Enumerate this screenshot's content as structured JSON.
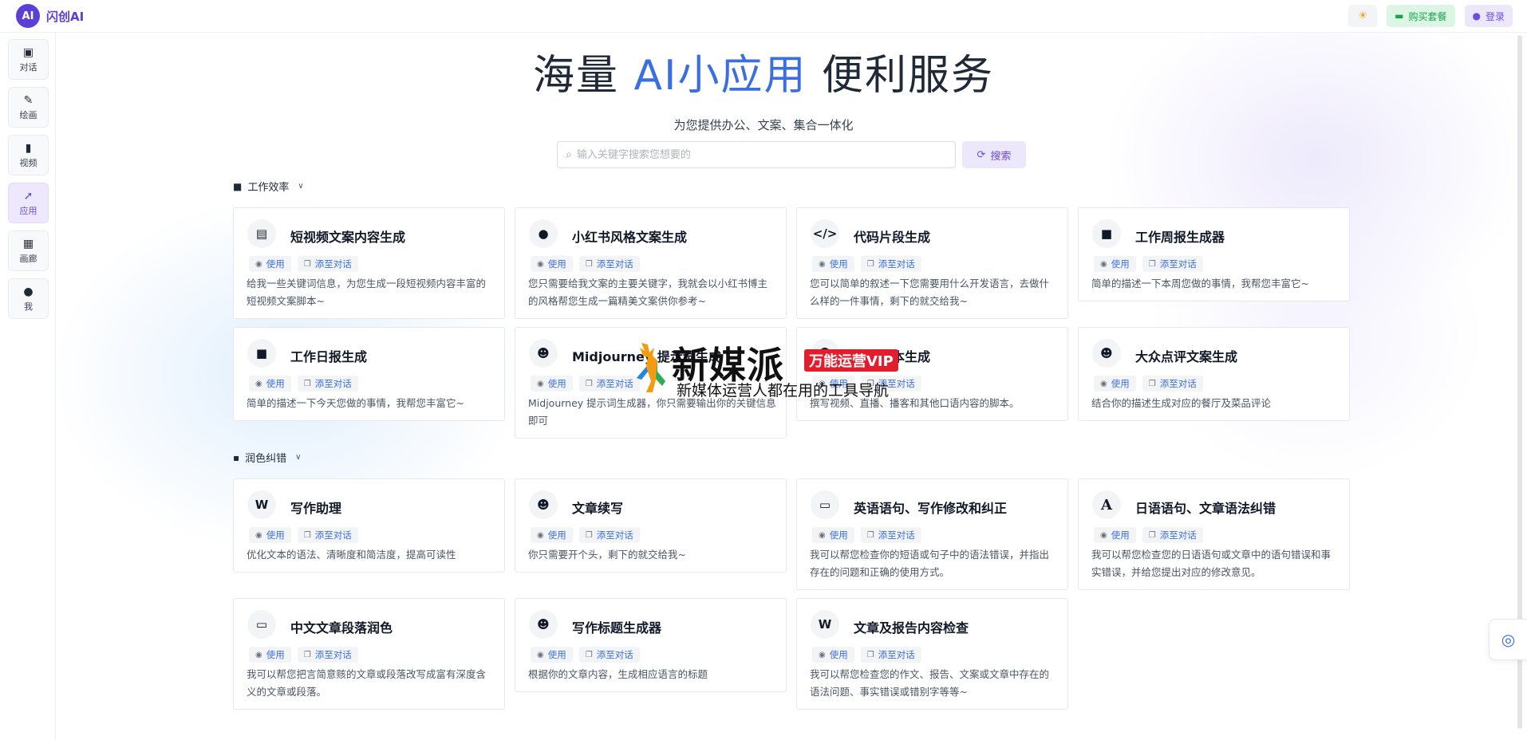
{
  "app": {
    "logo_mark": "AI",
    "name": "闪创AI"
  },
  "topbar": {
    "theme_icon": "sun-icon",
    "buy_label": "购买套餐",
    "login_label": "登录"
  },
  "sidebar": {
    "items": [
      {
        "label": "对话",
        "icon": "chat-icon"
      },
      {
        "label": "绘画",
        "icon": "brush-icon"
      },
      {
        "label": "视频",
        "icon": "video-icon"
      },
      {
        "label": "应用",
        "icon": "rocket-icon",
        "active": true
      },
      {
        "label": "画廊",
        "icon": "gallery-icon"
      },
      {
        "label": "我",
        "icon": "user-icon"
      }
    ]
  },
  "hero": {
    "title_pre": "海量 ",
    "title_accent": "AI小应用",
    "title_post": " 便利服务",
    "subtitle": "为您提供办公、文案、集合一体化"
  },
  "search": {
    "placeholder": "输入关键字搜索您想要的",
    "button": "搜索"
  },
  "card_actions": {
    "use": "使用",
    "add": "添至对话"
  },
  "sections": [
    {
      "title": "工作效率",
      "cards": [
        {
          "title": "短视频文案内容生成",
          "icon": "image-stack-icon",
          "desc": "给我一些关键词信息，为您生成一段短视频内容丰富的短视频文案脚本~"
        },
        {
          "title": "小红书风格文案生成",
          "icon": "cookie-icon",
          "desc": "您只需要给我文案的主要关键字，我就会以小红书博主的风格帮您生成一篇精美文案供你参考~"
        },
        {
          "title": "代码片段生成",
          "icon": "code-icon",
          "desc": "您可以简单的叙述一下您需要用什么开发语言，去做什么样的一件事情，剩下的就交给我~"
        },
        {
          "title": "工作周报生成器",
          "icon": "briefcase-icon",
          "desc": "简单的描述一下本周您做的事情，我帮您丰富它~"
        },
        {
          "title": "工作日报生成",
          "icon": "briefcase-icon",
          "desc": "简单的描述一下今天您做的事情，我帮您丰富它~"
        },
        {
          "title": "Midjourney 提示词生成",
          "icon": "smile-icon",
          "desc": "Midjourney 提示词生成器，你只需要输出你的关键信息即可"
        },
        {
          "title": "口播脚本生成",
          "icon": "smile-icon",
          "desc": "撰写视频、直播、播客和其他口语内容的脚本。"
        },
        {
          "title": "大众点评文案生成",
          "icon": "smile-icon",
          "desc": "结合你的描述生成对应的餐厅及菜品评论"
        }
      ]
    },
    {
      "title": "润色纠错",
      "cards": [
        {
          "title": "写作助理",
          "icon": "word-doc-icon",
          "desc": "优化文本的语法、清晰度和简洁度，提高可读性"
        },
        {
          "title": "文章续写",
          "icon": "smile-icon",
          "desc": "你只需要开个头，剩下的就交给我~"
        },
        {
          "title": "英语语句、写作修改和纠正",
          "icon": "translate-icon",
          "desc": "我可以帮您检查你的短语或句子中的语法错误，并指出存在的问题和正确的使用方式。"
        },
        {
          "title": "日语语句、文章语法纠错",
          "icon": "font-icon",
          "desc": "我可以帮您检查您的日语语句或文章中的语句错误和事实错误，并给您提出对应的修改意见。"
        },
        {
          "title": "中文文章段落润色",
          "icon": "translate-icon",
          "desc": "我可以帮您把言简意赅的文章或段落改写成富有深度含义的文章或段落。"
        },
        {
          "title": "写作标题生成器",
          "icon": "smile-icon",
          "desc": "根据你的文章内容，生成相应语言的标题"
        },
        {
          "title": "文章及报告内容检查",
          "icon": "word-doc-icon",
          "desc": "我可以帮您检查您的作文、报告、文案或文章中存在的语法问题、事实错误或错别字等等~"
        }
      ]
    }
  ],
  "watermark": {
    "main": "新媒派",
    "badge": "万能运营VIP",
    "sub": "新媒体运营人都在用的工具导航"
  },
  "float_button": {
    "icon": "assistant-icon"
  }
}
